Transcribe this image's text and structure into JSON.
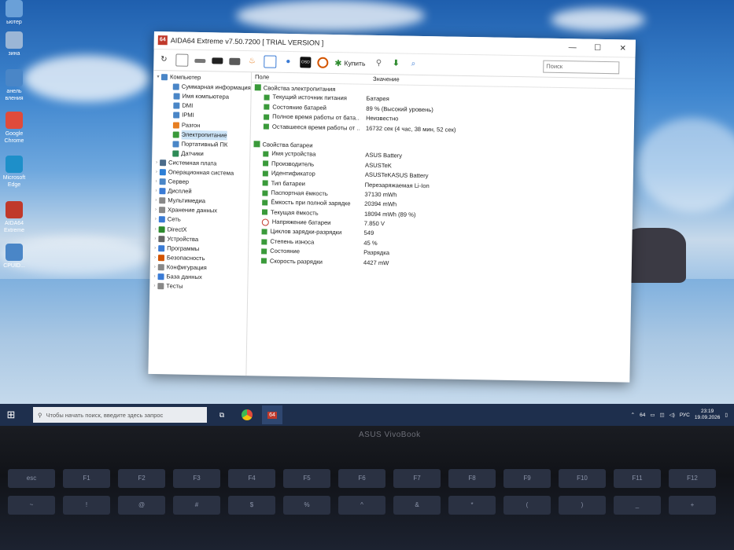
{
  "desktop": {
    "icons": [
      {
        "label": "ьютер",
        "color": "#6aa0d8"
      },
      {
        "label": "зина",
        "color": "#9bb6d6"
      },
      {
        "label": "анель вления",
        "color": "#4a86c7"
      },
      {
        "label": "Google Chrome",
        "color": "#e04b3b"
      },
      {
        "label": "Microsoft Edge",
        "color": "#1e8fc9"
      },
      {
        "label": "AIDA64 Extreme",
        "color": "#c0392b"
      },
      {
        "label": "CPUID...",
        "color": "#4a86c7"
      }
    ]
  },
  "window": {
    "title": "AIDA64 Extreme v7.50.7200  [ TRIAL VERSION ]",
    "app_icon_text": "64",
    "controls": {
      "minimize": "—",
      "maximize": "☐",
      "close": "✕"
    },
    "toolbar": {
      "buy_label": "Купить",
      "search_placeholder": "Поиск"
    },
    "tree": [
      {
        "label": "Компьютер",
        "level": 0,
        "toggle": "▾",
        "icon_color": "#4a86c7"
      },
      {
        "label": "Суммарная информация",
        "level": 1,
        "toggle": "",
        "icon_color": "#4a86c7"
      },
      {
        "label": "Имя компьютера",
        "level": 1,
        "toggle": "",
        "icon_color": "#4a86c7"
      },
      {
        "label": "DMI",
        "level": 1,
        "toggle": "",
        "icon_color": "#4a86c7"
      },
      {
        "label": "IPMI",
        "level": 1,
        "toggle": "",
        "icon_color": "#4a86c7"
      },
      {
        "label": "Разгон",
        "level": 1,
        "toggle": "",
        "icon_color": "#e67e22"
      },
      {
        "label": "Электропитание",
        "level": 1,
        "toggle": "",
        "icon_color": "#3a9a3a",
        "selected": true
      },
      {
        "label": "Портативный ПК",
        "level": 1,
        "toggle": "",
        "icon_color": "#4a86c7"
      },
      {
        "label": "Датчики",
        "level": 1,
        "toggle": "",
        "icon_color": "#2e8b57"
      },
      {
        "label": "Системная плата",
        "level": 0,
        "toggle": "›",
        "icon_color": "#4a6b8a"
      },
      {
        "label": "Операционная система",
        "level": 0,
        "toggle": "›",
        "icon_color": "#2c7fd6"
      },
      {
        "label": "Сервер",
        "level": 0,
        "toggle": "›",
        "icon_color": "#4a86c7"
      },
      {
        "label": "Дисплей",
        "level": 0,
        "toggle": "›",
        "icon_color": "#3a7bd5"
      },
      {
        "label": "Мультимедиа",
        "level": 0,
        "toggle": "›",
        "icon_color": "#888888"
      },
      {
        "label": "Хранение данных",
        "level": 0,
        "toggle": "›",
        "icon_color": "#888888"
      },
      {
        "label": "Сеть",
        "level": 0,
        "toggle": "›",
        "icon_color": "#3a7bd5"
      },
      {
        "label": "DirectX",
        "level": 0,
        "toggle": "›",
        "icon_color": "#2e8b2e"
      },
      {
        "label": "Устройства",
        "level": 0,
        "toggle": "›",
        "icon_color": "#666666"
      },
      {
        "label": "Программы",
        "level": 0,
        "toggle": "›",
        "icon_color": "#3a7bd5"
      },
      {
        "label": "Безопасность",
        "level": 0,
        "toggle": "›",
        "icon_color": "#d35400"
      },
      {
        "label": "Конфигурация",
        "level": 0,
        "toggle": "›",
        "icon_color": "#888888"
      },
      {
        "label": "База данных",
        "level": 0,
        "toggle": "›",
        "icon_color": "#3a7bd5"
      },
      {
        "label": "Тесты",
        "level": 0,
        "toggle": "›",
        "icon_color": "#888888"
      }
    ],
    "columns": {
      "field": "Поле",
      "value": "Значение"
    },
    "sections": [
      {
        "title": "Свойства электропитания",
        "rows": [
          {
            "name": "Текущий источник питания",
            "value": "Батарея",
            "icon": "green"
          },
          {
            "name": "Состояние батарей",
            "value": "89 % (Высокий уровень)",
            "icon": "green"
          },
          {
            "name": "Полное время работы от бата...",
            "value": "Неизвестно",
            "icon": "green"
          },
          {
            "name": "Оставшееся время работы от ...",
            "value": "16732 сек (4 час, 38 мин, 52 сек)",
            "icon": "green"
          }
        ]
      },
      {
        "title": "Свойства батареи",
        "rows": [
          {
            "name": "Имя устройства",
            "value": "ASUS Battery",
            "icon": "green"
          },
          {
            "name": "Производитель",
            "value": "ASUSTeK",
            "icon": "green"
          },
          {
            "name": "Идентификатор",
            "value": "ASUSTeKASUS Battery",
            "icon": "green"
          },
          {
            "name": "Тип батареи",
            "value": "Перезаряжаемая Li-Ion",
            "icon": "green"
          },
          {
            "name": "Паспортная ёмкость",
            "value": "37130 mWh",
            "icon": "green"
          },
          {
            "name": "Ёмкость при полной зарядке",
            "value": "20394 mWh",
            "icon": "green"
          },
          {
            "name": "Текущая ёмкость",
            "value": "18094 mWh  (89 %)",
            "icon": "green"
          },
          {
            "name": "Напряжение батареи",
            "value": "7.850 V",
            "icon": "red"
          },
          {
            "name": "Циклов зарядки-разрядки",
            "value": "549",
            "icon": "green"
          },
          {
            "name": "Степень износа",
            "value": "45 %",
            "icon": "green"
          },
          {
            "name": "Состояние",
            "value": "Разрядка",
            "icon": "green"
          },
          {
            "name": "Скорость разрядки",
            "value": "4427 mW",
            "icon": "green"
          }
        ]
      }
    ]
  },
  "taskbar": {
    "search_placeholder": "Чтобы начать поиск, введите здесь запрос",
    "lang": "РУС",
    "time": "23:19",
    "date": "19.09.2026"
  },
  "laptop": {
    "brand": "ASUS VivoBook"
  },
  "keyboard": {
    "keys": [
      "esc",
      "F1",
      "F2",
      "F3",
      "F4",
      "F5",
      "F6",
      "F7",
      "F8",
      "F9",
      "F10",
      "F11",
      "F12",
      "~",
      "!",
      "@",
      "#",
      "$",
      "%",
      "^",
      "&",
      "*",
      "(",
      ")",
      "_",
      "+"
    ]
  }
}
